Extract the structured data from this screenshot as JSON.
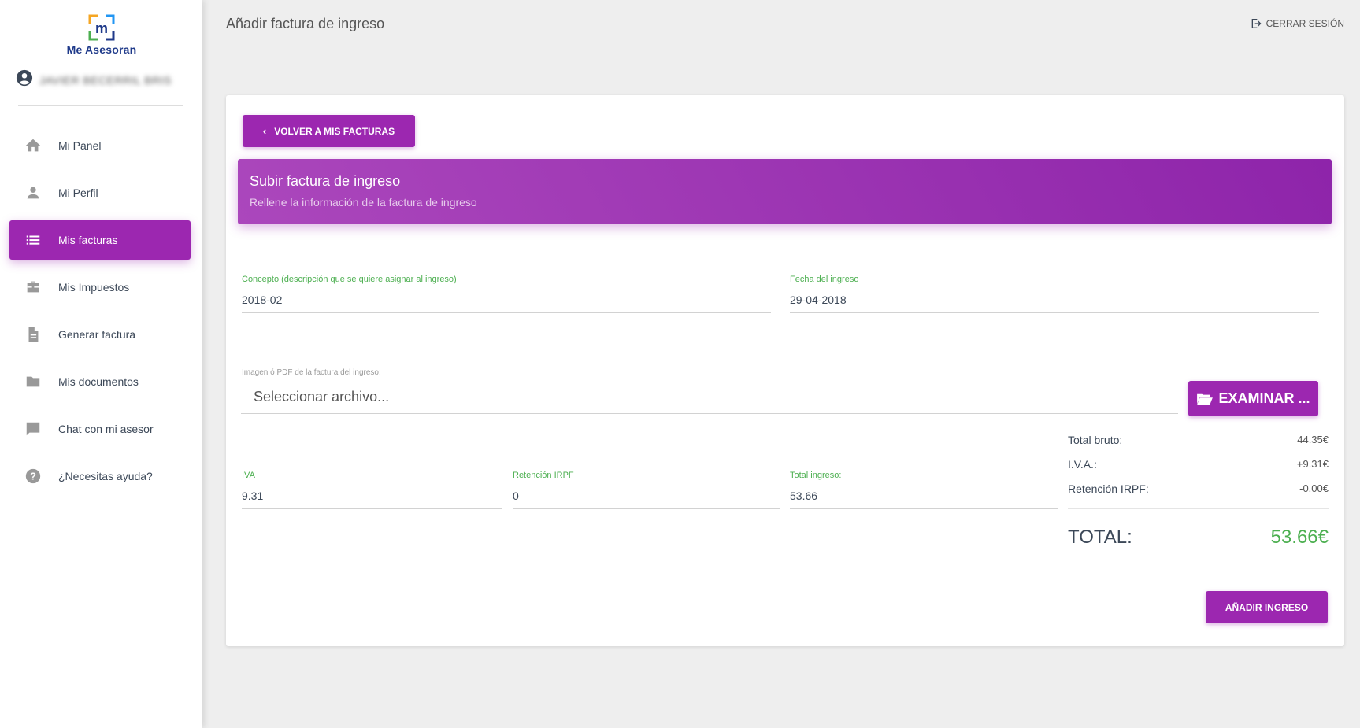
{
  "brand": {
    "name": "Me Asesoran",
    "logo_letter": "m"
  },
  "user": {
    "name": "JAVIER BECERRIL BRIS"
  },
  "sidebar": {
    "items": [
      {
        "label": "Mi Panel",
        "icon": "home-icon"
      },
      {
        "label": "Mi Perfil",
        "icon": "person-icon"
      },
      {
        "label": "Mis facturas",
        "icon": "list-icon",
        "active": true
      },
      {
        "label": "Mis Impuestos",
        "icon": "briefcase-icon"
      },
      {
        "label": "Generar factura",
        "icon": "document-icon"
      },
      {
        "label": "Mis documentos",
        "icon": "folder-icon"
      },
      {
        "label": "Chat con mi asesor",
        "icon": "chat-icon"
      },
      {
        "label": "¿Necesitas ayuda?",
        "icon": "help-icon"
      }
    ]
  },
  "header": {
    "title": "Añadir factura de ingreso",
    "logout_label": "CERRAR SESIÓN"
  },
  "card": {
    "back_label": "VOLVER A MIS FACTURAS",
    "title": "Subir factura de ingreso",
    "subtitle": "Rellene la información de la factura de ingreso"
  },
  "form": {
    "concepto": {
      "label": "Concepto (descripción que se quiere asignar al ingreso)",
      "value": "2018-02"
    },
    "fecha": {
      "label": "Fecha del ingreso",
      "value": "29-04-2018"
    },
    "archivo": {
      "label": "Imagen ó PDF de la factura del ingreso:",
      "placeholder": "Seleccionar archivo...",
      "browse_label": "EXAMINAR ..."
    },
    "iva": {
      "label": "IVA",
      "value": "9.31"
    },
    "retencion": {
      "label": "Retención IRPF",
      "value": "0"
    },
    "total": {
      "label": "Total ingreso:",
      "value": "53.66"
    }
  },
  "totals": {
    "bruto_label": "Total bruto:",
    "bruto_value": "44.35€",
    "iva_label": "I.V.A.:",
    "iva_value": "+9.31€",
    "irpf_label": "Retención IRPF:",
    "irpf_value": "-0.00€",
    "total_label": "TOTAL:",
    "total_value": "53.66€"
  },
  "actions": {
    "add_label": "AÑADIR INGRESO"
  },
  "colors": {
    "accent": "#9c27b0",
    "success": "#4caf50",
    "brand_blue": "#1f3a8a"
  }
}
